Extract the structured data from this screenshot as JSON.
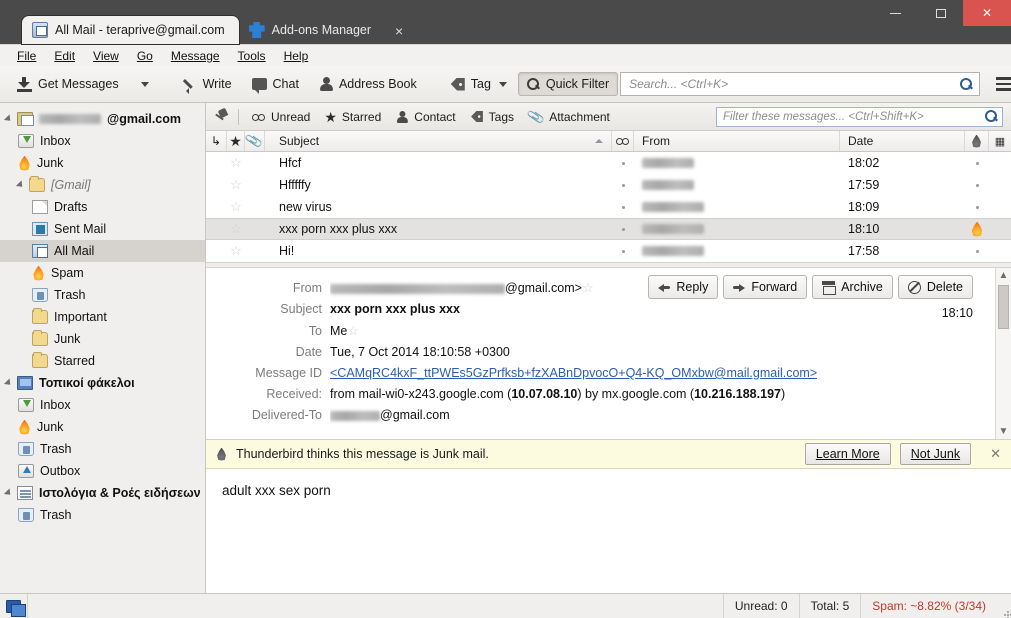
{
  "window": {
    "tabs": [
      {
        "title": "All Mail - teraprive@gmail.com",
        "icon": "all-mail-icon",
        "active": true
      },
      {
        "title": "Add-ons Manager",
        "icon": "addon-puzzle-icon",
        "active": false
      }
    ],
    "tab_close_label": "×",
    "controls": {
      "minimize": "–",
      "maximize": "□",
      "close": "✕"
    }
  },
  "menubar": {
    "items": [
      "File",
      "Edit",
      "View",
      "Go",
      "Message",
      "Tools",
      "Help"
    ]
  },
  "toolbar": {
    "get_messages": "Get Messages",
    "write": "Write",
    "chat": "Chat",
    "address_book": "Address Book",
    "tag": "Tag",
    "quick_filter": "Quick Filter",
    "search_placeholder": "Search... <Ctrl+K>"
  },
  "sidebar": {
    "accounts": [
      {
        "label": "@gmail.com",
        "redacted_prefix": true,
        "redacted_width": 62,
        "icon": "account-icon",
        "indent": 0,
        "twisty": true,
        "selected": false,
        "italic": false
      },
      {
        "label": "Inbox",
        "icon": "inbox-icon",
        "indent": 1,
        "twisty": false,
        "selected": false,
        "italic": false
      },
      {
        "label": "Junk",
        "icon": "junk-flame-icon",
        "indent": 1,
        "twisty": false,
        "selected": false,
        "italic": false
      },
      {
        "label": "[Gmail]",
        "icon": "folder-icon",
        "indent": 1,
        "twisty": true,
        "selected": false,
        "italic": true
      },
      {
        "label": "Drafts",
        "icon": "draft-doc-icon",
        "indent": 2,
        "twisty": false,
        "selected": false,
        "italic": false
      },
      {
        "label": "Sent Mail",
        "icon": "sent-mail-icon",
        "indent": 2,
        "twisty": false,
        "selected": false,
        "italic": false
      },
      {
        "label": "All Mail",
        "icon": "all-mail-icon",
        "indent": 2,
        "twisty": false,
        "selected": true,
        "italic": false
      },
      {
        "label": "Spam",
        "icon": "junk-flame-icon",
        "indent": 2,
        "twisty": false,
        "selected": false,
        "italic": false
      },
      {
        "label": "Trash",
        "icon": "trash-icon",
        "indent": 2,
        "twisty": false,
        "selected": false,
        "italic": false
      },
      {
        "label": "Important",
        "icon": "folder-icon",
        "indent": 2,
        "twisty": false,
        "selected": false,
        "italic": false
      },
      {
        "label": "Junk",
        "icon": "folder-icon",
        "indent": 2,
        "twisty": false,
        "selected": false,
        "italic": false
      },
      {
        "label": "Starred",
        "icon": "folder-icon",
        "indent": 2,
        "twisty": false,
        "selected": false,
        "italic": false
      },
      {
        "label": "Τοπικοί φάκελοι",
        "icon": "local-folders-icon",
        "indent": 0,
        "twisty": true,
        "selected": false,
        "italic": false,
        "bold": true
      },
      {
        "label": "Inbox",
        "icon": "inbox-icon",
        "indent": 1,
        "twisty": false,
        "selected": false,
        "italic": false
      },
      {
        "label": "Junk",
        "icon": "junk-flame-icon",
        "indent": 1,
        "twisty": false,
        "selected": false,
        "italic": false
      },
      {
        "label": "Trash",
        "icon": "trash-icon",
        "indent": 1,
        "twisty": false,
        "selected": false,
        "italic": false
      },
      {
        "label": "Outbox",
        "icon": "outbox-icon",
        "indent": 1,
        "twisty": false,
        "selected": false,
        "italic": false
      },
      {
        "label": "Ιστολόγια & Ροές ειδήσεων",
        "icon": "feeds-icon",
        "indent": 0,
        "twisty": true,
        "selected": false,
        "italic": false,
        "bold": true
      },
      {
        "label": "Trash",
        "icon": "trash-icon",
        "indent": 1,
        "twisty": false,
        "selected": false,
        "italic": false
      }
    ]
  },
  "quick_filter": {
    "pin_label": "pin-icon",
    "unread": "Unread",
    "starred": "Starred",
    "contact": "Contact",
    "tags": "Tags",
    "attachment": "Attachment",
    "filter_placeholder": "Filter these messages... <Ctrl+Shift+K>"
  },
  "message_list": {
    "columns": {
      "thread": "thread-column",
      "star": "star-column",
      "attachment": "attachment-column",
      "subject": "Subject",
      "read": "read-column",
      "from": "From",
      "date": "Date",
      "junk": "junk-column",
      "chooser": "column-chooser"
    },
    "sort": "ascending",
    "rows": [
      {
        "subject": "Hfcf",
        "from": "",
        "from_redacted_width": 52,
        "date": "18:02",
        "selected": false,
        "junk": false
      },
      {
        "subject": "Hfffffy",
        "from": "",
        "from_redacted_width": 52,
        "date": "17:59",
        "selected": false,
        "junk": false
      },
      {
        "subject": "new virus",
        "from": "",
        "from_redacted_width": 62,
        "date": "18:09",
        "selected": false,
        "junk": false
      },
      {
        "subject": "xxx porn xxx plus xxx",
        "from": "",
        "from_redacted_width": 62,
        "date": "18:10",
        "selected": true,
        "junk": true
      },
      {
        "subject": "Hi!",
        "from": "",
        "from_redacted_width": 62,
        "date": "17:58",
        "selected": false,
        "junk": false
      }
    ]
  },
  "message_header": {
    "labels": {
      "from": "From",
      "subject": "Subject",
      "to": "To",
      "date": "Date",
      "message_id": "Message ID",
      "received": "Received:",
      "delivered_to": "Delivered-To"
    },
    "from_suffix": "@gmail.com>",
    "from_redacted_width": 175,
    "subject": "xxx porn xxx plus xxx",
    "to": "Me",
    "date": "Tue, 7 Oct 2014 18:10:58 +0300",
    "message_id": "<CAMqRC4kxF_ttPWEs5GzPrfksb+fzXABnDpvocO+Q4-KQ_OMxbw@mail.gmail.com>",
    "received_prefix": "from  mail-wi0-x243.google.com (",
    "received_ip1": "10.07.08.10",
    "received_mid": ") by  mx.google.com (",
    "received_ip2": "10.216.188.197",
    "received_suffix": ")",
    "delivered_to_suffix": "@gmail.com",
    "delivered_to_redacted_width": 50,
    "time": "18:10",
    "actions": {
      "reply": "Reply",
      "forward": "Forward",
      "archive": "Archive",
      "delete": "Delete"
    }
  },
  "junk_notification": {
    "text": "Thunderbird thinks this message is Junk mail.",
    "learn_more": "Learn More",
    "not_junk": "Not Junk",
    "close": "✕"
  },
  "message_body": {
    "text": "adult xxx sex porn"
  },
  "status_bar": {
    "unread": "Unread: 0",
    "total": "Total: 5",
    "spam": "Spam: ~8.82% (3/34)"
  },
  "colors": {
    "titlebar": "#4a4a4a",
    "close_button": "#d9534f",
    "chrome": "#f2f1f0",
    "selection": "#e4e2e0",
    "sidebar_selection": "#d6d3cf",
    "junk_bar": "#fcfbdf",
    "link": "#2a5db0",
    "spam_text": "#c0392b"
  }
}
